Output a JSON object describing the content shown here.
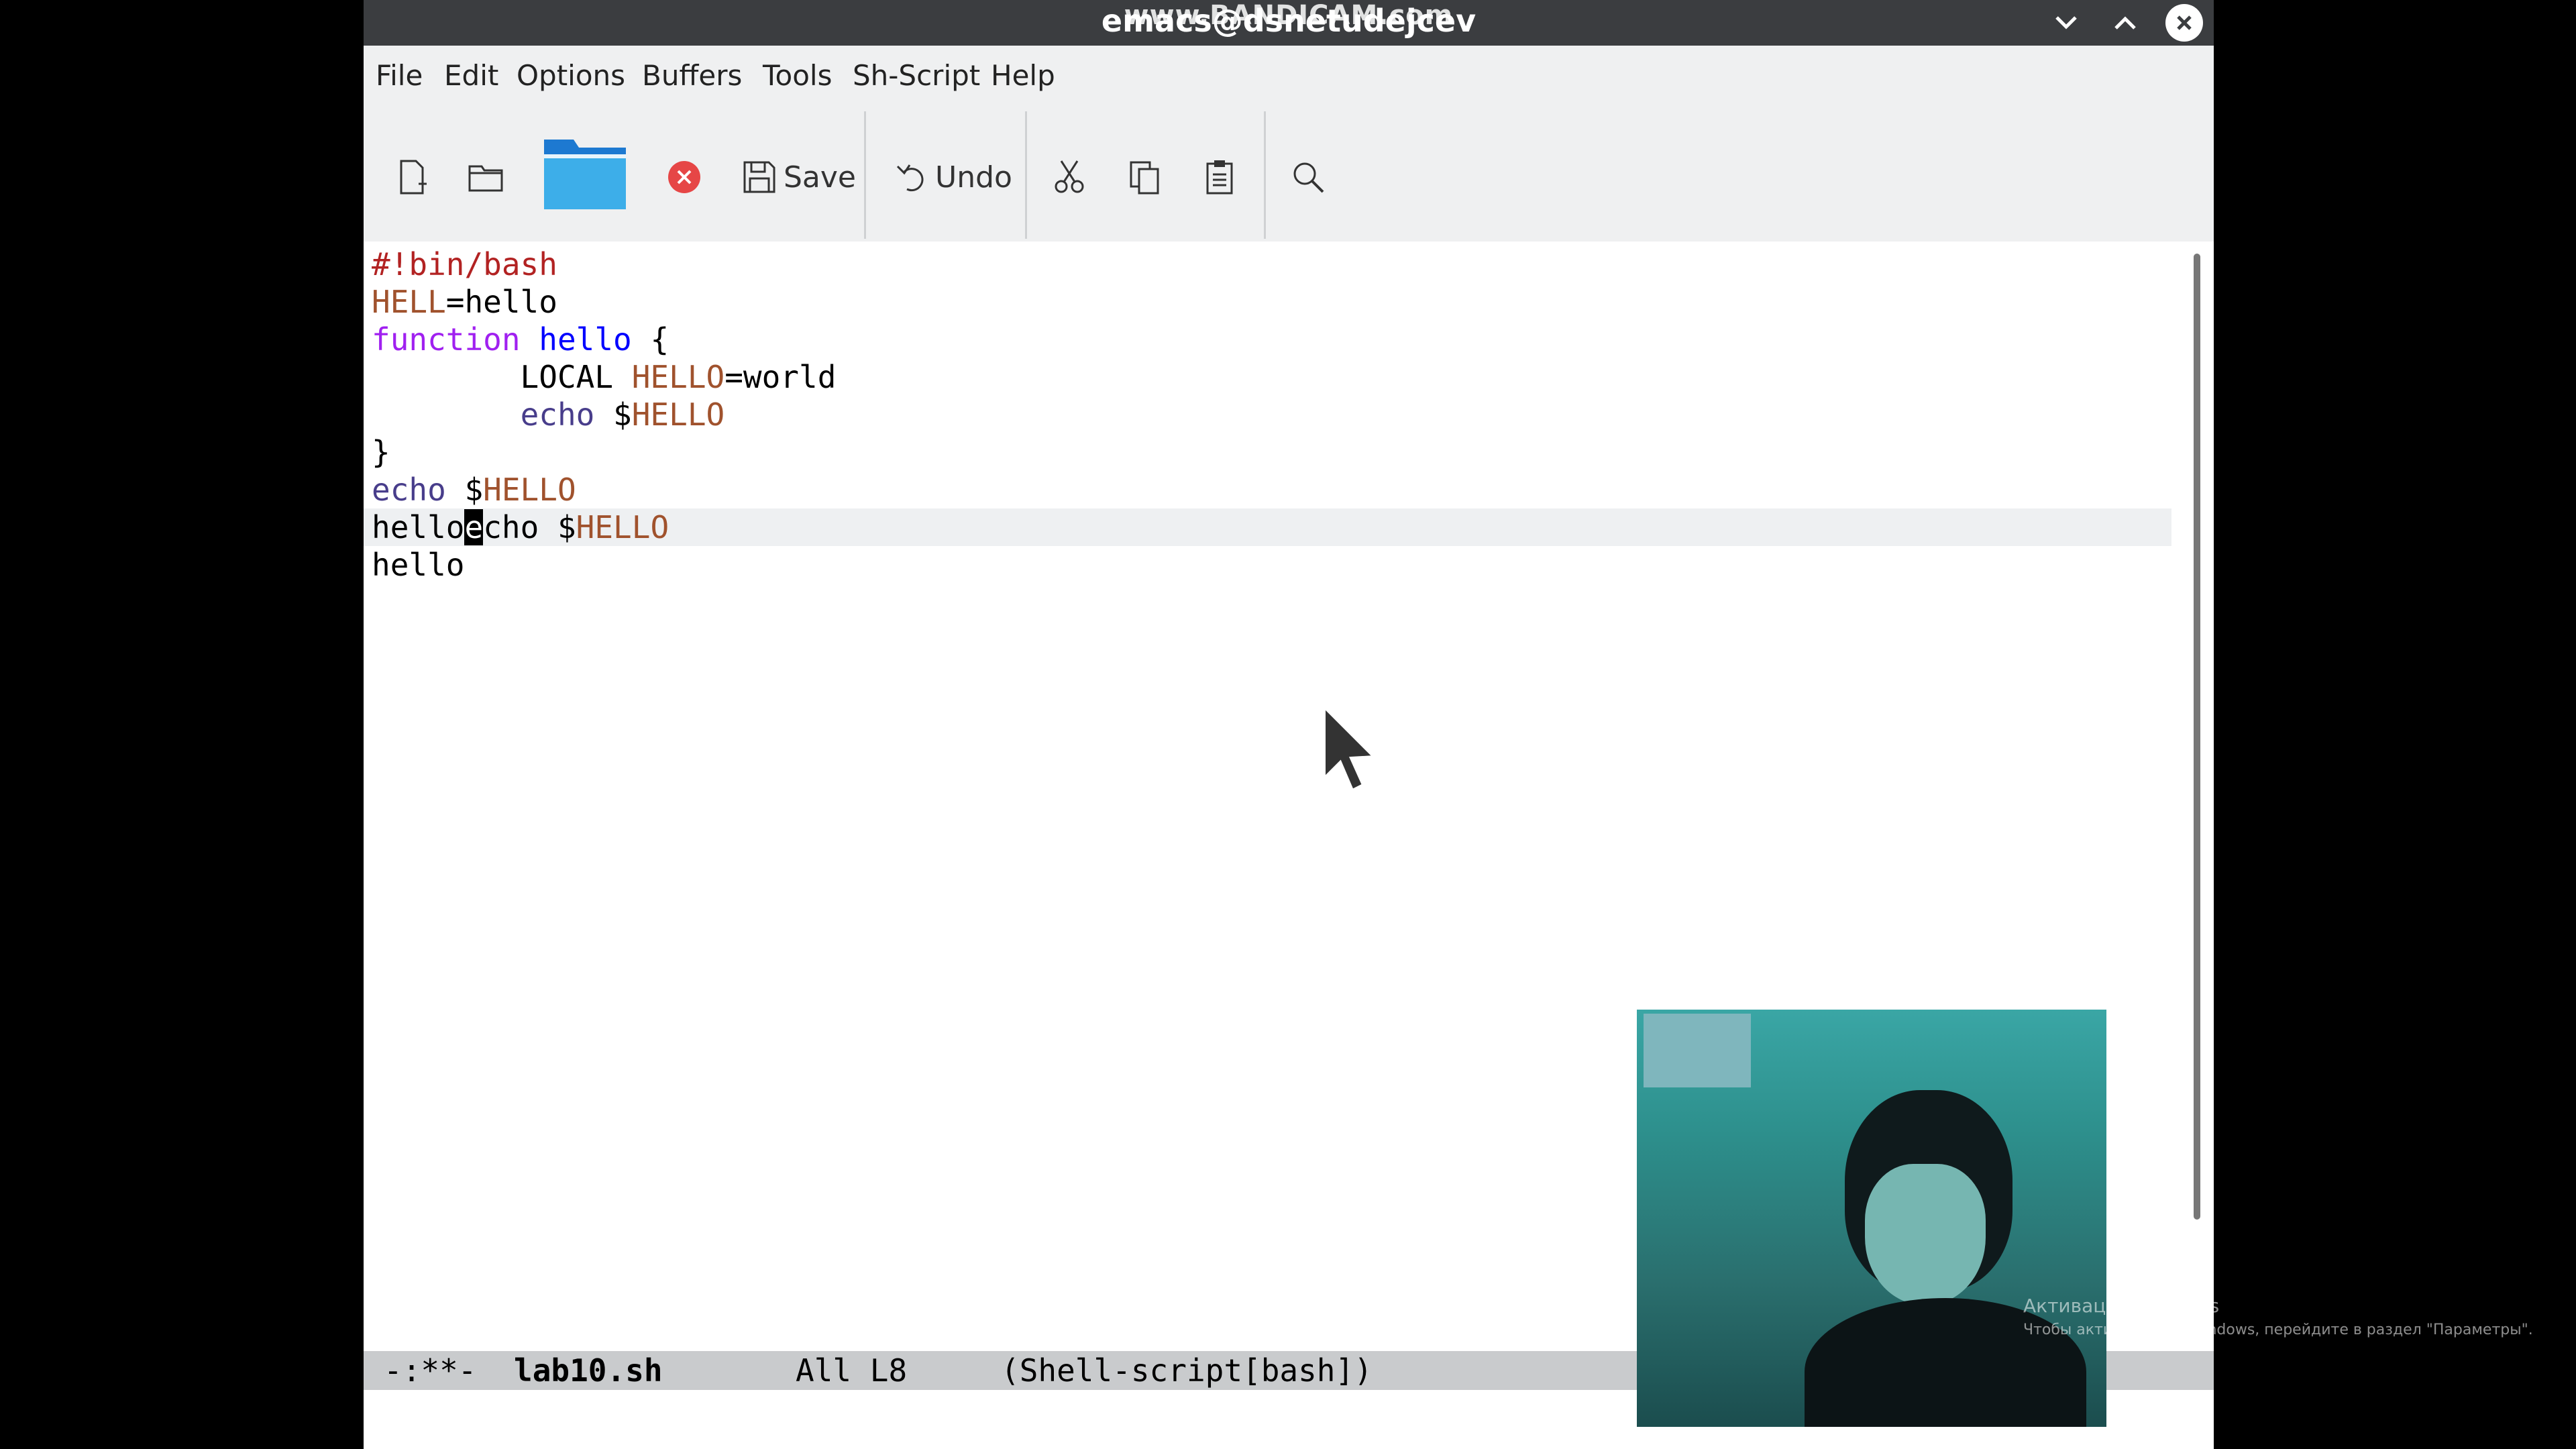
{
  "titlebar": {
    "title": "emacs@dsnetudejcev",
    "watermark": "www.BANDICAM.com"
  },
  "menu": [
    "File",
    "Edit",
    "Options",
    "Buffers",
    "Tools",
    "Sh-Script",
    "Help"
  ],
  "toolbar": {
    "save_label": "Save",
    "undo_label": "Undo"
  },
  "editor": {
    "lines": [
      [
        {
          "t": "#!bin/bash",
          "c": "c-comment"
        }
      ],
      [
        {
          "t": "HELL",
          "c": "c-var"
        },
        {
          "t": "=hello",
          "c": ""
        }
      ],
      [
        {
          "t": "function",
          "c": "c-kw"
        },
        {
          "t": " ",
          "c": ""
        },
        {
          "t": "hello",
          "c": "c-fn"
        },
        {
          "t": " {",
          "c": ""
        }
      ],
      [
        {
          "t": "        LOCAL ",
          "c": ""
        },
        {
          "t": "HELLO",
          "c": "c-var"
        },
        {
          "t": "=world",
          "c": ""
        }
      ],
      [
        {
          "t": "        ",
          "c": ""
        },
        {
          "t": "echo",
          "c": "c-builtin"
        },
        {
          "t": " $",
          "c": ""
        },
        {
          "t": "HELLO",
          "c": "c-var"
        }
      ],
      [
        {
          "t": "}",
          "c": ""
        }
      ],
      [
        {
          "t": "echo",
          "c": "c-builtin"
        },
        {
          "t": " $",
          "c": ""
        },
        {
          "t": "HELLO",
          "c": "c-var"
        }
      ],
      [
        {
          "t": "hello",
          "c": ""
        },
        {
          "t": "e",
          "c": "cursor"
        },
        {
          "t": "cho $",
          "c": ""
        },
        {
          "t": "HELLO",
          "c": "c-var"
        }
      ],
      [
        {
          "t": "hello",
          "c": ""
        }
      ]
    ],
    "current_line_index": 7
  },
  "modeline": {
    "status": "-:**-",
    "buffer": "lab10.sh",
    "position": "All L8",
    "mode": "(Shell-script[bash])"
  },
  "overlay": {
    "activate_title": "Активация Windows",
    "activate_sub": "Чтобы активировать Windows, перейдите в раздел \"Параметры\"."
  },
  "colors": {
    "titlebar": "#3b3d40",
    "menubar": "#eff0f1",
    "modeline": "#c9cbcd"
  }
}
